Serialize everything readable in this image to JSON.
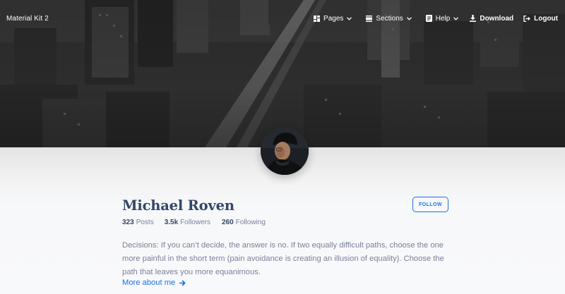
{
  "navbar": {
    "brand": "Material Kit 2",
    "items": [
      {
        "label": "Pages",
        "icon": "dashboard-icon",
        "dropdown": true
      },
      {
        "label": "Sections",
        "icon": "view-day-icon",
        "dropdown": true
      },
      {
        "label": "Help",
        "icon": "article-icon",
        "dropdown": true
      },
      {
        "label": "Download",
        "icon": "download-icon"
      },
      {
        "label": "Logout",
        "icon": "logout-icon"
      }
    ]
  },
  "profile": {
    "name": "Michael Roven",
    "follow_label": "FOLLOW",
    "stats": [
      {
        "value": "323",
        "label": "Posts"
      },
      {
        "value": "3.5k",
        "label": "Followers"
      },
      {
        "value": "260",
        "label": "Following"
      }
    ],
    "bio": "Decisions: If you can’t decide, the answer is no. If two equally difficult paths, choose the one more painful in the short term (pain avoidance is creating an illusion of equality). Choose the path that leaves you more equanimous.",
    "more_link": "More about me"
  },
  "colors": {
    "accent": "#1A73E8",
    "heading": "#344767",
    "muted": "#7b809a"
  }
}
